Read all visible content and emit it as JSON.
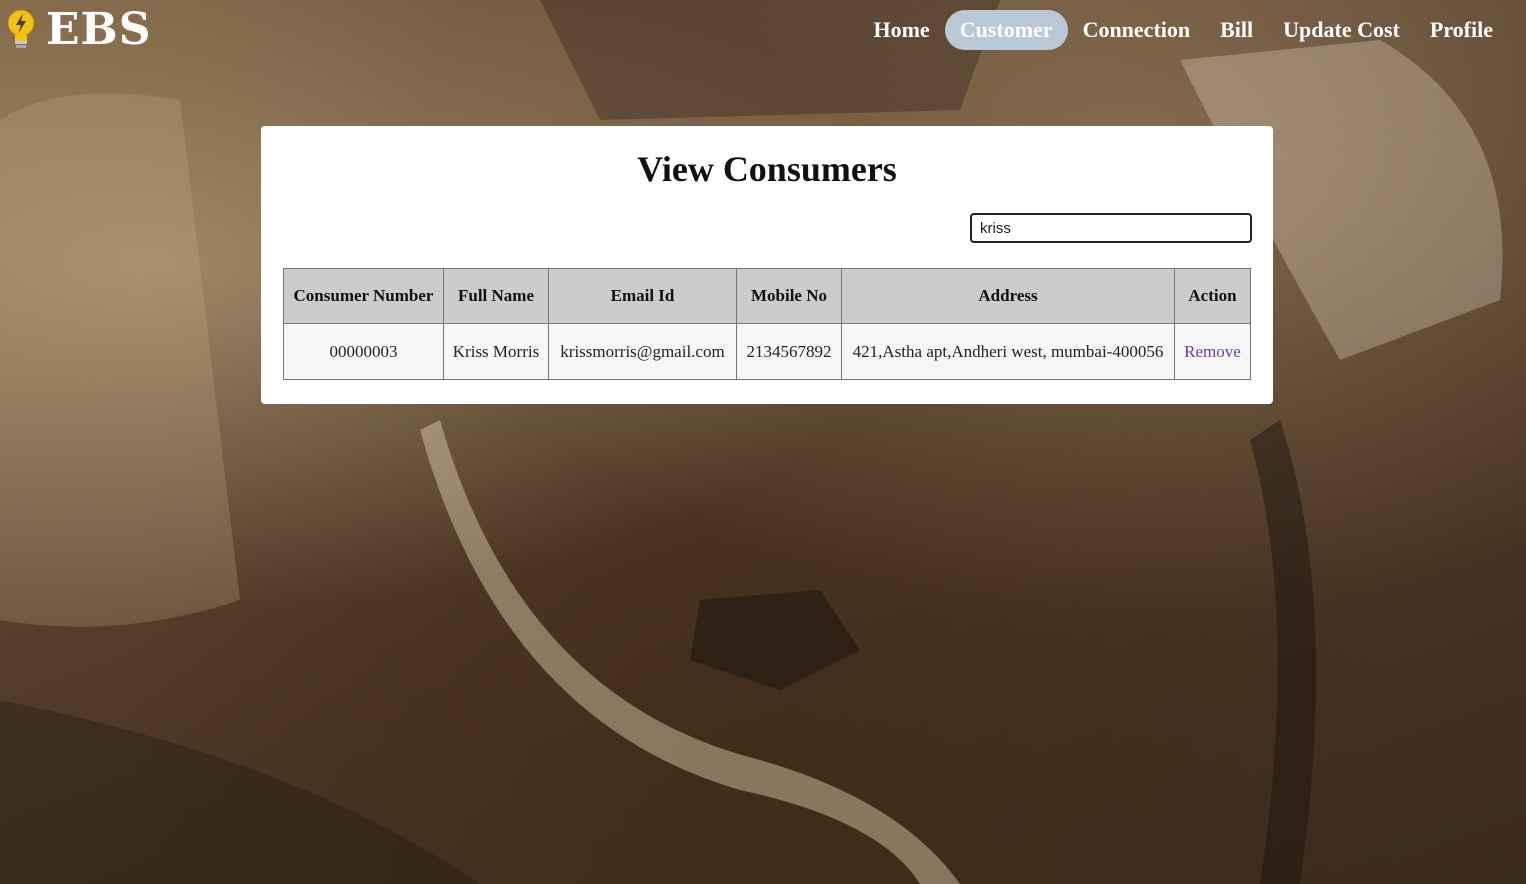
{
  "app": {
    "name": "EBS"
  },
  "nav": {
    "items": [
      {
        "label": "Home"
      },
      {
        "label": "Customer",
        "active": true
      },
      {
        "label": "Connection"
      },
      {
        "label": "Bill"
      },
      {
        "label": "Update Cost"
      },
      {
        "label": "Profile"
      }
    ]
  },
  "page": {
    "title": "View Consumers"
  },
  "search": {
    "value": "kriss"
  },
  "table": {
    "headers": [
      "Consumer Number",
      "Full Name",
      "Email Id",
      "Mobile No",
      "Address",
      "Action"
    ],
    "rows": [
      {
        "consumer_number": "00000003",
        "full_name": "Kriss Morris",
        "email": "krissmorris@gmail.com",
        "mobile": "2134567892",
        "address": "421,Astha apt,Andheri west, mumbai-400056",
        "action": "Remove"
      }
    ]
  },
  "colors": {
    "nav_active_bg": "#b9c8d4",
    "link": "#6b3f99",
    "header_bg": "#cccccc"
  },
  "icons": {
    "logo": "lightbulb-icon"
  }
}
